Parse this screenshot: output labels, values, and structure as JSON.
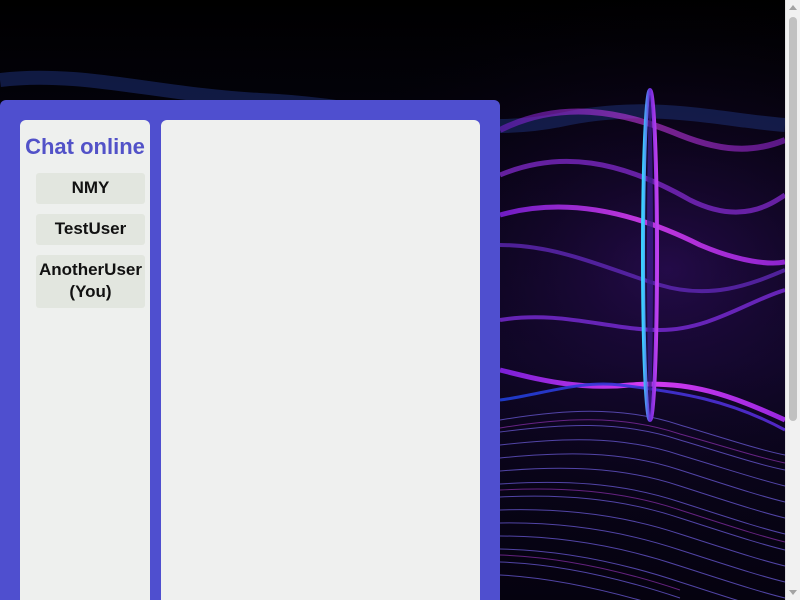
{
  "sidebar": {
    "title": "Chat online",
    "users": [
      "NMY",
      "TestUser",
      "AnotherUser (You)"
    ]
  },
  "colors": {
    "window": "#4f4fcf",
    "panel": "#eef0ee",
    "user_item": "#e2e6df",
    "title": "#5252c8"
  },
  "background": {
    "icon": "purple-wave-background"
  }
}
